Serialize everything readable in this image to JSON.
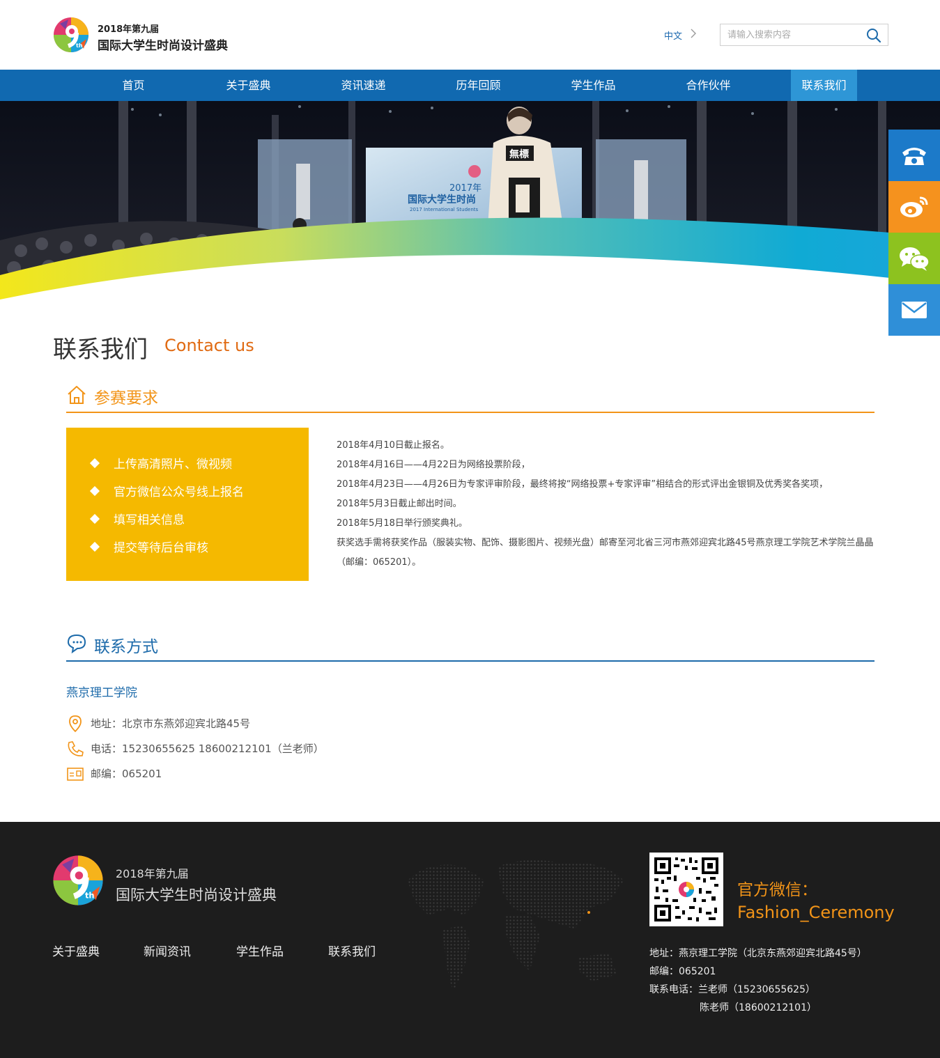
{
  "header": {
    "logo_line1": "2018年第九届",
    "logo_line2": "国际大学生时尚设计盛典",
    "lang": "中文",
    "search_placeholder": "请输入搜索内容"
  },
  "nav": {
    "items": [
      "首页",
      "关于盛典",
      "资讯速递",
      "历年回顾",
      "学生作品",
      "合作伙伴",
      "联系我们"
    ],
    "active_index": 6
  },
  "banner": {
    "stage_title": "2017年",
    "stage_subtitle": "国际大学生时尚",
    "stage_small": "2017 International Students",
    "jacket_text": "無標"
  },
  "side_bar": {
    "icons": [
      "phone-icon",
      "weibo-icon",
      "wechat-icon",
      "mail-icon"
    ],
    "colors": [
      "#1c7ac9",
      "#f5921e",
      "#8dc21f",
      "#2f8fd8"
    ]
  },
  "page": {
    "title": "联系我们",
    "title_en": "Contact us"
  },
  "requirements": {
    "heading": "参赛要求",
    "steps": [
      "上传高清照片、微视频",
      "官方微信公众号线上报名",
      "填写相关信息",
      "提交等待后台审核"
    ],
    "lines": [
      "2018年4月10日截止报名。",
      "2018年4月16日——4月22日为网络投票阶段，",
      "2018年4月23日——4月26日为专家评审阶段，最终将按“网络投票+专家评审”相结合的形式评出金银铜及优秀奖各奖项，",
      "2018年5月3日截止邮出时间。",
      "2018年5月18日举行颁奖典礼。",
      "获奖选手需将获奖作品（服装实物、配饰、摄影图片、视频光盘）邮寄至河北省三河市燕郊迎宾北路45号燕京理工学院艺术学院兰晶晶（邮编：065201）。"
    ]
  },
  "contact": {
    "heading": "联系方式",
    "school": "燕京理工学院",
    "address": "地址：北京市东燕郊迎宾北路45号",
    "phone": "电话：15230655625 18600212101（兰老师）",
    "postcode": "邮编：065201"
  },
  "footer": {
    "logo_line1": "2018年第九届",
    "logo_line2": "国际大学生时尚设计盛典",
    "links": [
      "关于盛典",
      "新闻资讯",
      "学生作品",
      "联系我们"
    ],
    "wechat_title": "官方微信：",
    "wechat_id": "Fashion_Ceremony",
    "address": "地址：燕京理工学院（北京东燕郊迎宾北路45号）",
    "postcode": "邮编：065201",
    "phone1": "联系电话：兰老师（15230655625）",
    "phone2": "陈老师（18600212101）"
  },
  "colors": {
    "nav_blue": "#1169b0",
    "nav_active": "#2e96d6",
    "accent_orange": "#e06a12",
    "section_orange": "#f29418",
    "section_blue": "#1c6aaa",
    "yellow_box": "#f5b900",
    "footer_bg": "#1d1d1d"
  }
}
